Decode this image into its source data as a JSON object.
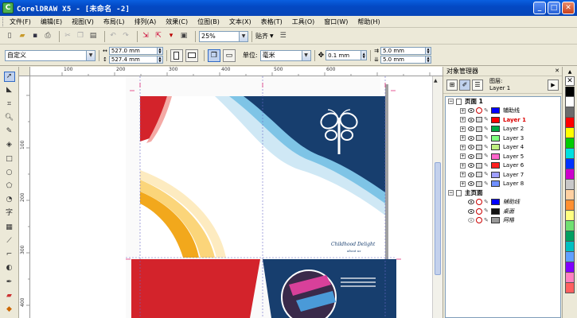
{
  "window": {
    "title": "CorelDRAW X5 - [未命名 -2]",
    "icon_letter": "C",
    "buttons": {
      "minimize": "_",
      "maximize": "□",
      "close": "✕"
    }
  },
  "menu": [
    "文件(F)",
    "编辑(E)",
    "视图(V)",
    "布局(L)",
    "排列(A)",
    "效果(C)",
    "位图(B)",
    "文本(X)",
    "表格(T)",
    "工具(O)",
    "窗口(W)",
    "帮助(H)"
  ],
  "toolbar": {
    "zoom": "25%",
    "snap": "贴齐"
  },
  "propbar": {
    "preset": "自定义",
    "width": "527.0 mm",
    "height": "527.4 mm",
    "units_label": "单位:",
    "units": "毫米",
    "nudge": "0.1 mm",
    "dup_x": "5.0 mm",
    "dup_y": "5.0 mm"
  },
  "rulers": {
    "h": [
      "100",
      "200",
      "300",
      "400",
      "500",
      "600"
    ],
    "v": [
      "100",
      "200",
      "300",
      "400"
    ]
  },
  "design": {
    "brand_text": "Childhood Delight",
    "brand_sub": "about us",
    "colors": {
      "navy": "#173e6e",
      "red": "#d3232b",
      "orange": "#f2a81c",
      "lightblue": "#7ec4e6"
    }
  },
  "panel": {
    "title": "对象管理器",
    "layer_label": "图层:",
    "current_layer": "Layer 1",
    "rows": [
      {
        "kind": "page",
        "label": "页面 1",
        "expand": "⊟"
      },
      {
        "kind": "layer",
        "label": "辅助线",
        "color": "#0000ff",
        "italic": false,
        "red": false
      },
      {
        "kind": "layer",
        "label": "Layer 1",
        "color": "#ff0000",
        "italic": false,
        "red": true
      },
      {
        "kind": "layer",
        "label": "Layer 2",
        "color": "#00aa44",
        "italic": false,
        "red": false
      },
      {
        "kind": "layer",
        "label": "Layer 3",
        "color": "#80ff80",
        "italic": false,
        "red": false
      },
      {
        "kind": "layer",
        "label": "Layer 4",
        "color": "#c0f080",
        "italic": false,
        "red": false
      },
      {
        "kind": "layer",
        "label": "Layer 5",
        "color": "#ff66cc",
        "italic": false,
        "red": false
      },
      {
        "kind": "layer",
        "label": "Layer 6",
        "color": "#ff2020",
        "italic": false,
        "red": false
      },
      {
        "kind": "layer",
        "label": "Layer 7",
        "color": "#a0a0ff",
        "italic": false,
        "red": false
      },
      {
        "kind": "layer",
        "label": "Layer 8",
        "color": "#7090ff",
        "italic": false,
        "red": false
      },
      {
        "kind": "page",
        "label": "主页面",
        "expand": "⊟"
      },
      {
        "kind": "master",
        "label": "辅助线",
        "color": "#0000ff",
        "italic": true
      },
      {
        "kind": "master",
        "label": "桌面",
        "color": "#111111",
        "italic": true
      },
      {
        "kind": "master",
        "label": "网格",
        "color": "#999999",
        "italic": true
      }
    ]
  },
  "palette": [
    "#000000",
    "#ffffff",
    "#6b6b6b",
    "#ff0000",
    "#ffff00",
    "#00cc00",
    "#00e0e0",
    "#0033ff",
    "#cc00cc",
    "#c8c8c8",
    "#ffd0a0",
    "#ff9030",
    "#ffff80",
    "#70e070",
    "#00a060",
    "#00c0c0",
    "#60a0ff",
    "#8000ff",
    "#ff80c0",
    "#ff6060"
  ]
}
